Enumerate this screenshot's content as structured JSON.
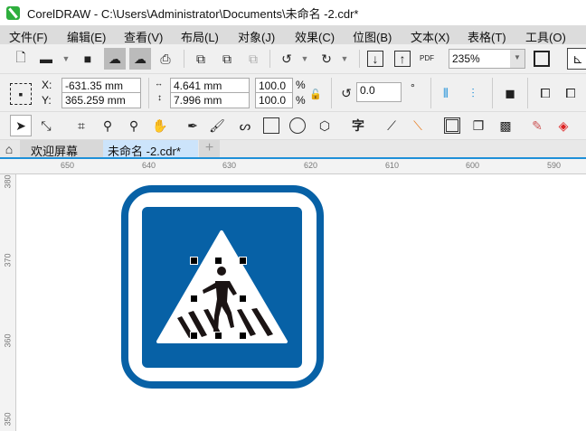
{
  "window": {
    "title": "CorelDRAW - C:\\Users\\Administrator\\Documents\\未命名 -2.cdr*"
  },
  "menu": [
    "文件(F)",
    "编辑(E)",
    "查看(V)",
    "布局(L)",
    "对象(J)",
    "效果(C)",
    "位图(B)",
    "文本(X)",
    "表格(T)",
    "工具(O)"
  ],
  "toolbar": {
    "zoom": "235%",
    "pdf_label": "PDF"
  },
  "properties": {
    "x_label": "X:",
    "y_label": "Y:",
    "x": "-631.35 mm",
    "y": "365.259 mm",
    "width": "4.641 mm",
    "height": "7.996 mm",
    "scale_x": "100.0",
    "scale_y": "100.0",
    "percent": "%",
    "rotation": "0.0",
    "degree": "°"
  },
  "tabs": [
    {
      "label": "欢迎屏幕"
    },
    {
      "label": "未命名 -2.cdr*"
    }
  ],
  "tab_add": "+",
  "ruler": {
    "h": [
      "650",
      "640",
      "630",
      "620",
      "610",
      "600",
      "590"
    ],
    "v": [
      "380",
      "370",
      "360",
      "350"
    ]
  },
  "colors": {
    "sign_blue": "#0761a6",
    "accent": "#1e90d8"
  }
}
